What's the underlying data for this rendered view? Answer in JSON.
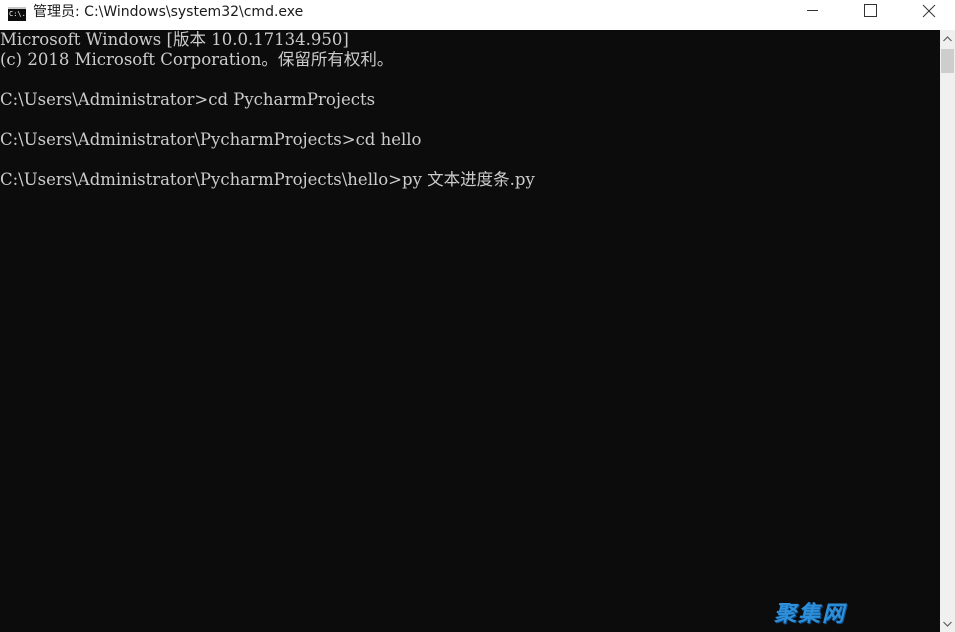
{
  "window": {
    "title": "管理员: C:\\Windows\\system32\\cmd.exe",
    "icon_text": "C:\\."
  },
  "console": {
    "lines": [
      "Microsoft Windows [版本 10.0.17134.950]",
      "(c) 2018 Microsoft Corporation。保留所有权利。",
      "C:\\Users\\Administrator>cd PycharmProjects",
      "C:\\Users\\Administrator\\PycharmProjects>cd hello",
      "C:\\Users\\Administrator\\PycharmProjects\\hello>py 文本进度条.py"
    ]
  },
  "icons": {
    "minimize": "minimize-icon",
    "maximize": "maximize-icon",
    "close": "close-icon",
    "scroll_up": "chevron-up-icon",
    "scroll_down": "chevron-down-icon"
  },
  "colors": {
    "console_bg": "#0c0c0c",
    "console_text": "#cccccc",
    "titlebar_bg": "#ffffff",
    "watermark": "#2f8fd8"
  },
  "watermark": {
    "text": "聚集网"
  }
}
